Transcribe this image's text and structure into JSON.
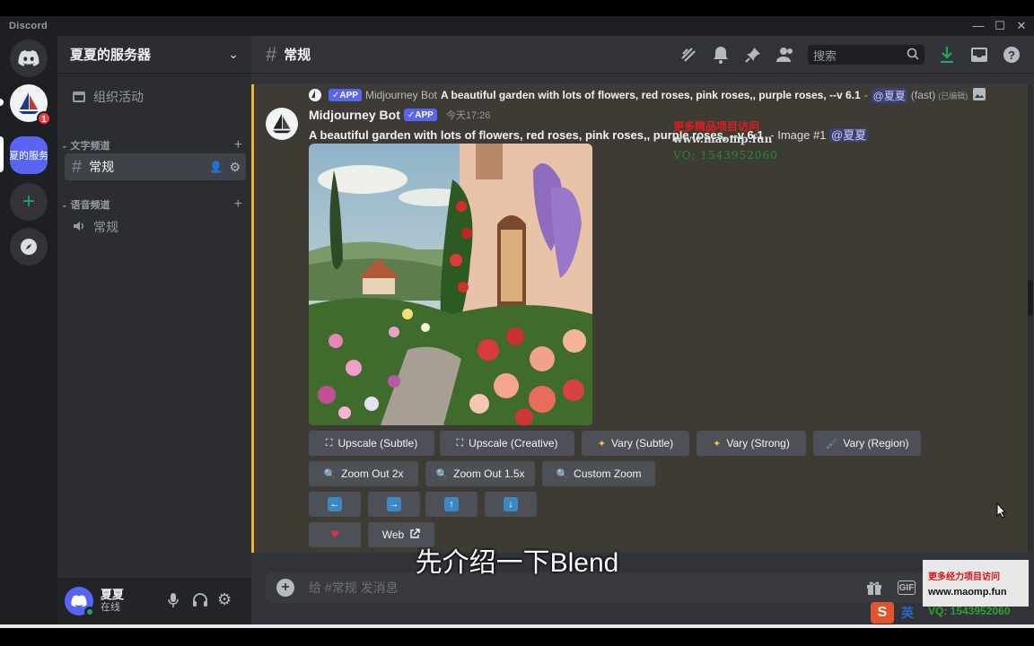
{
  "window": {
    "title": "Discord"
  },
  "guilds": {
    "server_short_label": "夏的服务",
    "badge": "1"
  },
  "sidebar": {
    "server_name": "夏夏的服务器",
    "events_label": "组织活动",
    "text_category": "文字频道",
    "text_channel": "常规",
    "voice_category": "语音频道",
    "voice_channel": "常规"
  },
  "user": {
    "name": "夏夏",
    "status": "在线"
  },
  "header": {
    "channel_name": "常规",
    "search_placeholder": "搜索"
  },
  "reply": {
    "app_tag": "APP",
    "author": "Midjourney Bot",
    "prompt": "A beautiful garden with lots of flowers, red roses, pink roses,, purple roses, --v 6.1",
    "separator": "-",
    "mention": "@夏夏",
    "mode": "(fast)",
    "edited": "(已编辑)"
  },
  "message": {
    "author": "Midjourney Bot",
    "app_tag": "APP",
    "timestamp": "今天17:26",
    "prompt": "A beautiful garden with lots of flowers, red roses, pink roses,, purple roses, --v 6.1",
    "suffix": "- Image #1",
    "mention": "@夏夏"
  },
  "buttons": {
    "upscale_subtle": "Upscale (Subtle)",
    "upscale_creative": "Upscale (Creative)",
    "vary_subtle": "Vary (Subtle)",
    "vary_strong": "Vary (Strong)",
    "vary_region": "Vary (Region)",
    "zoom_out_2x": "Zoom Out 2x",
    "zoom_out_15x": "Zoom Out 1.5x",
    "custom_zoom": "Custom Zoom",
    "web": "Web"
  },
  "composer": {
    "placeholder": "给 #常规 发消息",
    "gif_label": "GIF"
  },
  "overlay": {
    "subtitle": "先介绍一下Blend",
    "watermark_line1": "更多精品项目访问",
    "watermark_line2": "www.maomp.fun",
    "watermark_line3": "VQ: 1543952060",
    "promo_line1": "更多经力项目访问",
    "promo_line2": "www.maomp.fun",
    "promo_vq": "VQ: 1543952060",
    "ime_label": "英"
  },
  "colors": {
    "accent": "#5865f2",
    "highlight": "#f0b232",
    "online": "#23a55a",
    "danger": "#f23f43"
  }
}
